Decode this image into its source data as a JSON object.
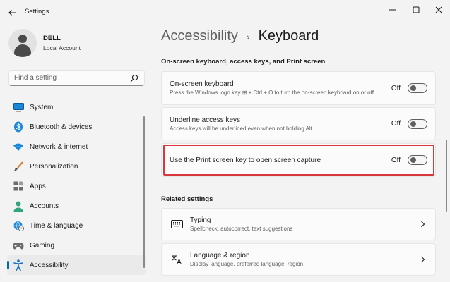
{
  "window": {
    "title": "Settings"
  },
  "profile": {
    "name": "DELL",
    "account": "Local Account"
  },
  "search": {
    "placeholder": "Find a setting"
  },
  "sidebar": {
    "items": [
      {
        "label": "System",
        "icon": "system-icon",
        "active": false
      },
      {
        "label": "Bluetooth & devices",
        "icon": "bluetooth-icon",
        "active": false
      },
      {
        "label": "Network & internet",
        "icon": "wifi-icon",
        "active": false
      },
      {
        "label": "Personalization",
        "icon": "brush-icon",
        "active": false
      },
      {
        "label": "Apps",
        "icon": "apps-icon",
        "active": false
      },
      {
        "label": "Accounts",
        "icon": "person-icon",
        "active": false
      },
      {
        "label": "Time & language",
        "icon": "globe-clock-icon",
        "active": false
      },
      {
        "label": "Gaming",
        "icon": "controller-icon",
        "active": false
      },
      {
        "label": "Accessibility",
        "icon": "accessibility-icon",
        "active": true
      }
    ]
  },
  "breadcrumb": {
    "parent": "Accessibility",
    "separator": "›",
    "current": "Keyboard"
  },
  "section_osk": {
    "title": "On-screen keyboard, access keys, and Print screen",
    "items": [
      {
        "title": "On-screen keyboard",
        "desc": "Press the Windows logo key ⊞ + Ctrl + O to turn the on-screen keyboard on or off",
        "state": "Off"
      },
      {
        "title": "Underline access keys",
        "desc": "Access keys will be underlined even when not holding Alt",
        "state": "Off"
      },
      {
        "title": "Use the Print screen key to open screen capture",
        "desc": "",
        "state": "Off"
      }
    ]
  },
  "related": {
    "title": "Related settings",
    "items": [
      {
        "title": "Typing",
        "desc": "Spellcheck, autocorrect, text suggestions",
        "icon": "keyboard-icon"
      },
      {
        "title": "Language & region",
        "desc": "Display language, preferred language, region",
        "icon": "language-icon"
      }
    ]
  },
  "colors": {
    "accent": "#0067c0",
    "highlight": "#d8373d"
  }
}
